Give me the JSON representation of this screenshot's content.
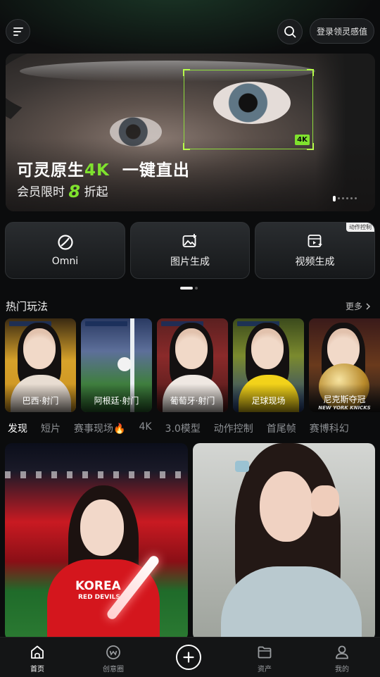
{
  "header": {
    "menu_icon": "menu-icon",
    "search_icon": "search-icon",
    "login_label": "登录领灵感值"
  },
  "banner": {
    "title_part1": "可灵原生",
    "title_accent": "4K",
    "title_part2": "一键直出",
    "subtitle_part1": "会员限时",
    "subtitle_big": "8",
    "subtitle_part2": "折起",
    "badge": "4K",
    "accent_color": "#7fe22e",
    "slide_count": 6,
    "active_slide": 1
  },
  "features": [
    {
      "label": "Omni",
      "icon": "omni-icon"
    },
    {
      "label": "图片生成",
      "icon": "image-generate-icon"
    },
    {
      "label": "视频生成",
      "icon": "video-generate-icon",
      "tag": "动作控制"
    }
  ],
  "hot": {
    "title": "热门玩法",
    "more": "更多",
    "items": [
      {
        "label": "巴西·射门"
      },
      {
        "label": "阿根廷·射门"
      },
      {
        "label": "葡萄牙·射门"
      },
      {
        "label": "足球现场"
      },
      {
        "label": "尼克斯夺冠"
      }
    ],
    "watermark": "NEW YORK KNICKS"
  },
  "tabs": [
    {
      "label": "发现",
      "active": true
    },
    {
      "label": "短片"
    },
    {
      "label": "赛事现场🔥"
    },
    {
      "label": "4K"
    },
    {
      "label": "3.0模型"
    },
    {
      "label": "动作控制"
    },
    {
      "label": "首尾帧"
    },
    {
      "label": "赛博科幻"
    }
  ],
  "feed": {
    "card1_text": "KOREA",
    "card1_subtext": "RED DEVILS"
  },
  "bottom_nav": [
    {
      "label": "首页",
      "icon": "home-icon",
      "active": true
    },
    {
      "label": "创意圈",
      "icon": "community-icon"
    },
    {
      "label": "",
      "icon": "add-icon"
    },
    {
      "label": "资产",
      "icon": "folder-icon"
    },
    {
      "label": "我的",
      "icon": "profile-icon"
    }
  ]
}
